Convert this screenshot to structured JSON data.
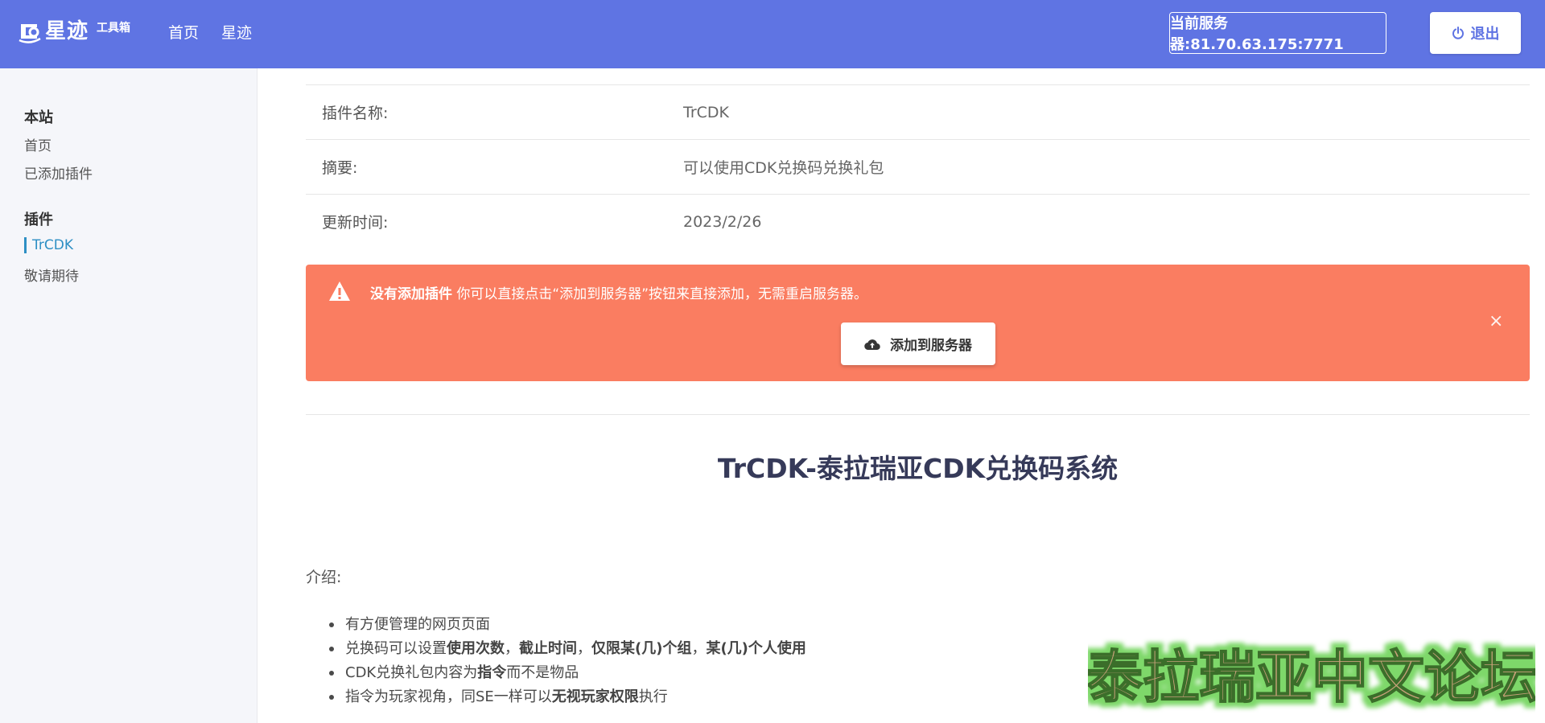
{
  "header": {
    "brand_name": "星迹",
    "brand_sub": "工具箱",
    "nav": [
      "首页",
      "星迹"
    ],
    "server_label": "当前服务器:81.70.63.175:7771",
    "logout_label": "退出",
    "bg_color": "#5f74e3"
  },
  "sidebar": {
    "sections": [
      {
        "heading": "本站",
        "items": [
          {
            "label": "首页"
          },
          {
            "label": "已添加插件"
          }
        ]
      },
      {
        "heading": "插件",
        "items": [
          {
            "label": "TrCDK",
            "active": true
          },
          {
            "label": "敬请期待"
          }
        ]
      }
    ]
  },
  "plugin_info": [
    {
      "label": "插件名称:",
      "value": "TrCDK"
    },
    {
      "label": "摘要:",
      "value": "可以使用CDK兑换码兑换礼包"
    },
    {
      "label": "更新时间:",
      "value": "2023/2/26"
    }
  ],
  "alert": {
    "title": "没有添加插件",
    "message": " 你可以直接点击“添加到服务器”按钮来直接添加，无需重启服务器。",
    "button_label": "添加到服务器",
    "close_symbol": "×",
    "bg_color": "#fa7d61"
  },
  "doc": {
    "title": "TrCDK-泰拉瑞亚CDK兑换码系统",
    "intro_label": "介绍:",
    "features": [
      [
        {
          "t": "有方便管理的网页页面",
          "b": false
        }
      ],
      [
        {
          "t": "兑换码可以设置",
          "b": false
        },
        {
          "t": "使用次数",
          "b": true
        },
        {
          "t": "，",
          "b": false
        },
        {
          "t": "截止时间",
          "b": true
        },
        {
          "t": "，",
          "b": false
        },
        {
          "t": "仅限某(几)个组",
          "b": true
        },
        {
          "t": "，",
          "b": false
        },
        {
          "t": "某(几)个人使用",
          "b": true
        }
      ],
      [
        {
          "t": "CDK兑换礼包内容为",
          "b": false
        },
        {
          "t": "指令",
          "b": true
        },
        {
          "t": "而不是物品",
          "b": false
        }
      ],
      [
        {
          "t": "指令为玩家视角，同SE一样可以",
          "b": false
        },
        {
          "t": "无视玩家权限",
          "b": true
        },
        {
          "t": "执行",
          "b": false
        }
      ]
    ]
  },
  "watermark": {
    "text": "泰拉瑞亚中文论坛"
  }
}
